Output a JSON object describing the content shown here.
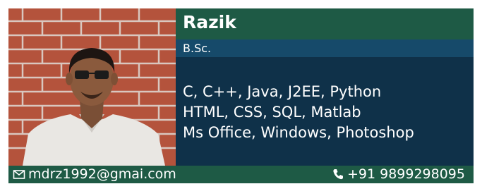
{
  "profile": {
    "name": "Razik",
    "degree": "B.Sc.",
    "skills": [
      "C, C++, Java, J2EE, Python",
      "HTML, CSS, SQL, Matlab",
      "Ms Office, Windows, Photoshop"
    ]
  },
  "contact": {
    "email": "mdrz1992@gmai.com",
    "email_icon": "mail-icon",
    "phone": "+91 9899298095",
    "phone_icon": "phone-icon"
  },
  "colors": {
    "header_green": "#1e5a45",
    "degree_blue": "#164a6a",
    "skills_navy": "#0f3149",
    "text": "#ffffff"
  }
}
